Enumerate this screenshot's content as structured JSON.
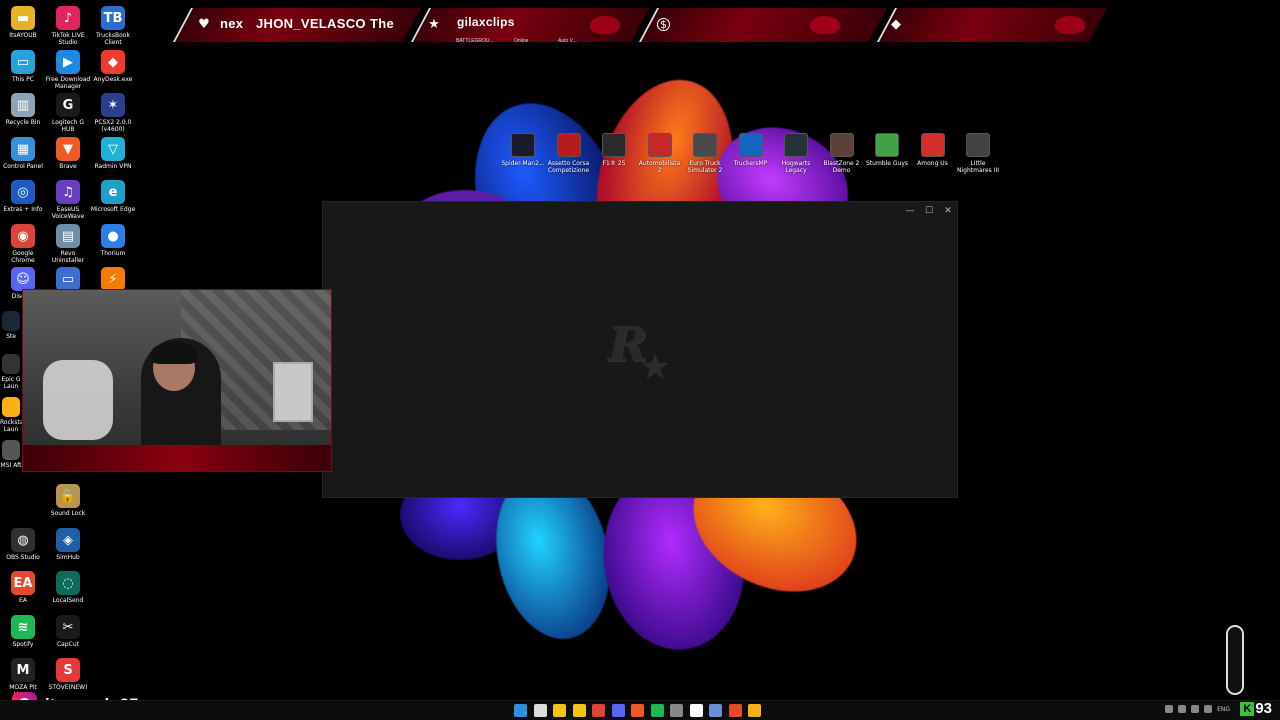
{
  "desktop_icons": [
    {
      "label": "ItsAYOUB",
      "color": "#e8b320",
      "glyph": "▬"
    },
    {
      "label": "TikTok LIVE Studio",
      "color": "#e0245e",
      "glyph": "♪"
    },
    {
      "label": "TrucksBook Client",
      "color": "#2a6fcf",
      "glyph": "TB"
    },
    {
      "label": "This PC",
      "color": "#2aa1d8",
      "glyph": "▭"
    },
    {
      "label": "Free Download Manager",
      "color": "#1e88e5",
      "glyph": "▶"
    },
    {
      "label": "AnyDesk.exe",
      "color": "#ef3b2d",
      "glyph": "◆"
    },
    {
      "label": "Recycle Bin",
      "color": "#8fa3b5",
      "glyph": "▥"
    },
    {
      "label": "Logitech G HUB",
      "color": "#1a1a1a",
      "glyph": "G"
    },
    {
      "label": "PCSX2 2.0.0 (v4600)",
      "color": "#2b3e8c",
      "glyph": "✶"
    },
    {
      "label": "Control Panel",
      "color": "#3a8fd6",
      "glyph": "▦"
    },
    {
      "label": "Brave",
      "color": "#f05a24",
      "glyph": "▼"
    },
    {
      "label": "Radmin VPN",
      "color": "#22b0d6",
      "glyph": "▽"
    },
    {
      "label": "Extras + Info",
      "color": "#1d5bbf",
      "glyph": "◎"
    },
    {
      "label": "EaseUS VoiceWave",
      "color": "#6a3fbf",
      "glyph": "♫"
    },
    {
      "label": "Microsoft Edge",
      "color": "#1fa0c9",
      "glyph": "e"
    },
    {
      "label": "Google Chrome",
      "color": "#db4437",
      "glyph": "◉"
    },
    {
      "label": "Revo Uninstaller",
      "color": "#6f8fa8",
      "glyph": "▤"
    },
    {
      "label": "Thorium",
      "color": "#2f7ee8",
      "glyph": "●"
    },
    {
      "label": "Discord",
      "color": "#5865f2",
      "glyph": "☺"
    },
    {
      "label": "",
      "color": "#3a6fcf",
      "glyph": "▭"
    },
    {
      "label": "ATK HUB",
      "color": "#f57c00",
      "glyph": "⚡"
    },
    {
      "label": "Sound Lock",
      "color": "#b8954a",
      "glyph": "🔒"
    },
    {
      "label": "OBS Studio",
      "color": "#303030",
      "glyph": "◍"
    },
    {
      "label": "SimHub",
      "color": "#1f5fa8",
      "glyph": "◈"
    },
    {
      "label": "EA",
      "color": "#e6492d",
      "glyph": "EA"
    },
    {
      "label": "LocalSend",
      "color": "#0f6b5a",
      "glyph": "◌"
    },
    {
      "label": "Spotify",
      "color": "#1db954",
      "glyph": "≋"
    },
    {
      "label": "CapCut",
      "color": "#1a1a1a",
      "glyph": "✂"
    },
    {
      "label": "MOZA Pit House",
      "color": "#222222",
      "glyph": "M"
    },
    {
      "label": "STOVE(NEW)",
      "color": "#e63a3a",
      "glyph": "S"
    }
  ],
  "partial_icons": [
    {
      "label": "Disc",
      "color": "#5865f2"
    },
    {
      "label": "Ste",
      "color": "#1b2838"
    },
    {
      "label": "Epic G Laun",
      "color": "#333333"
    },
    {
      "label": "Rocksta Laun",
      "color": "#fcaf17"
    },
    {
      "label": "MSI Aft",
      "color": "#555555"
    }
  ],
  "game_shortcuts": [
    {
      "label": "Spider-Man2...",
      "color": "#1a1a2e"
    },
    {
      "label": "Assetto Corsa Competizione",
      "color": "#b71c1c"
    },
    {
      "label": "F1® 25",
      "color": "#2a2a2a"
    },
    {
      "label": "Automobilista 2",
      "color": "#c62828"
    },
    {
      "label": "Euro Truck Simulator 2",
      "color": "#4a4a4a"
    },
    {
      "label": "TruckersMP",
      "color": "#1565c0"
    },
    {
      "label": "Hogwarts Legacy",
      "color": "#263238"
    },
    {
      "label": "BlastZone 2 Demo",
      "color": "#5d4037"
    },
    {
      "label": "Stumble Guys",
      "color": "#43a047"
    },
    {
      "label": "Among Us",
      "color": "#d32f2f"
    },
    {
      "label": "Little Nightmares III",
      "color": "#424242"
    }
  ],
  "overlay": {
    "ticker_left": "nex",
    "ticker_name": "JHON_VELASCO",
    "ticker_right": "The",
    "clip_user": "gilaxclips",
    "sub_labels": [
      "BATTLEGROU...",
      "Online",
      "Auto V..."
    ]
  },
  "social": {
    "instagram_handle": "itsayoub.25"
  },
  "counter": {
    "value": "93",
    "letter": "K"
  },
  "window_controls": {
    "minimize": "—",
    "maximize": "☐",
    "close": "✕"
  },
  "taskbar": {
    "lang": "ENG",
    "icons": [
      "#2f8fe0",
      "#dddddd",
      "#f0c419",
      "#f0c419",
      "#db4437",
      "#5865f2",
      "#f05a24",
      "#1db954",
      "#888888",
      "#ffffff",
      "#6a8fd6",
      "#e6492d",
      "#fcaf17"
    ]
  },
  "colors": {
    "accent_red": "#8a0010",
    "window_bg": "#181818"
  }
}
